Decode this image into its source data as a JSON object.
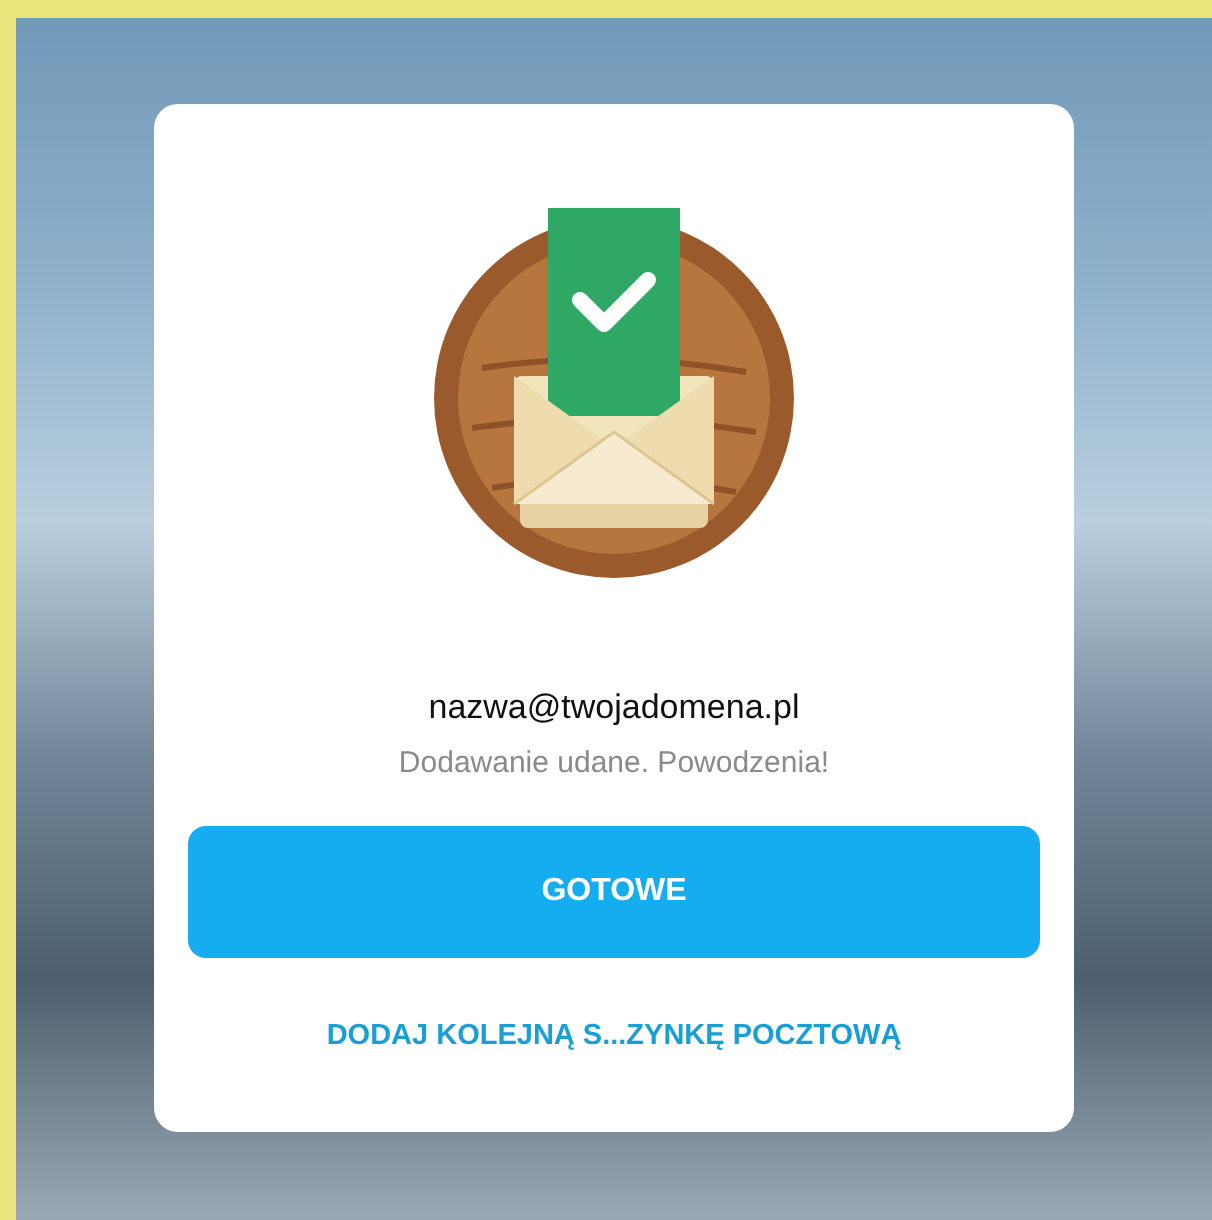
{
  "dialog": {
    "email": "nazwa@twojadomena.pl",
    "message": "Dodawanie udane. Powodzenia!",
    "primary_button": "GOTOWE",
    "secondary_link": "DODAJ KOLEJNĄ S...ZYNKĘ POCZTOWĄ"
  }
}
